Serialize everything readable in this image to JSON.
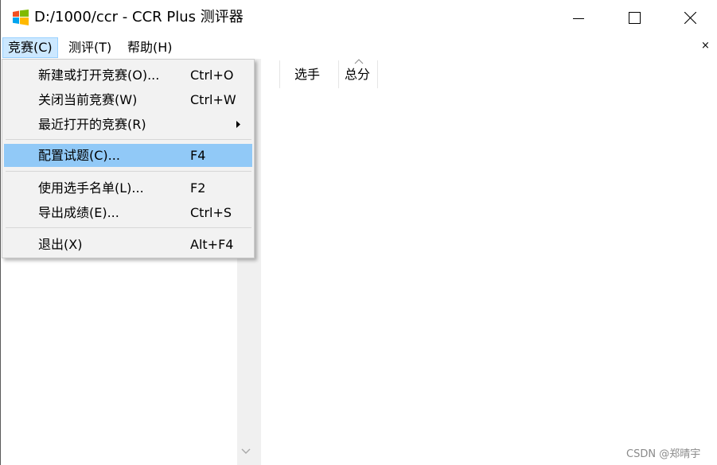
{
  "window": {
    "title": "D:/1000/ccr - CCR Plus 测评器",
    "icon": "windows-logo-icon",
    "controls": [
      "minimize-icon",
      "maximize-icon",
      "close-icon"
    ]
  },
  "menubar": {
    "items": [
      {
        "label": "竞赛(C)",
        "active": true
      },
      {
        "label": "测评(T)",
        "active": false
      },
      {
        "label": "帮助(H)",
        "active": false
      }
    ],
    "mdi_close": "×"
  },
  "table": {
    "columns": [
      {
        "label": "选手"
      },
      {
        "label": "总分",
        "sort_indicator": "chevron-up-icon"
      }
    ]
  },
  "contest_menu": {
    "items": [
      {
        "label": "新建或打开竞赛(O)...",
        "shortcut": "Ctrl+O"
      },
      {
        "label": "关闭当前竞赛(W)",
        "shortcut": "Ctrl+W"
      },
      {
        "label": "最近打开的竞赛(R)",
        "shortcut": "",
        "submenu": true
      },
      {
        "label": "配置试题(C)...",
        "shortcut": "F4",
        "highlighted": true
      },
      {
        "label": "使用选手名单(L)...",
        "shortcut": "F2"
      },
      {
        "label": "导出成绩(E)...",
        "shortcut": "Ctrl+S"
      },
      {
        "label": "退出(X)",
        "shortcut": "Alt+F4"
      }
    ]
  },
  "watermark": "CSDN @郑晴宇",
  "colors": {
    "menu_highlight": "#91c9f7",
    "menubar_active": "#cce8ff",
    "menu_background": "#f2f2f2",
    "scrollbar_track": "#f0f0f0"
  }
}
